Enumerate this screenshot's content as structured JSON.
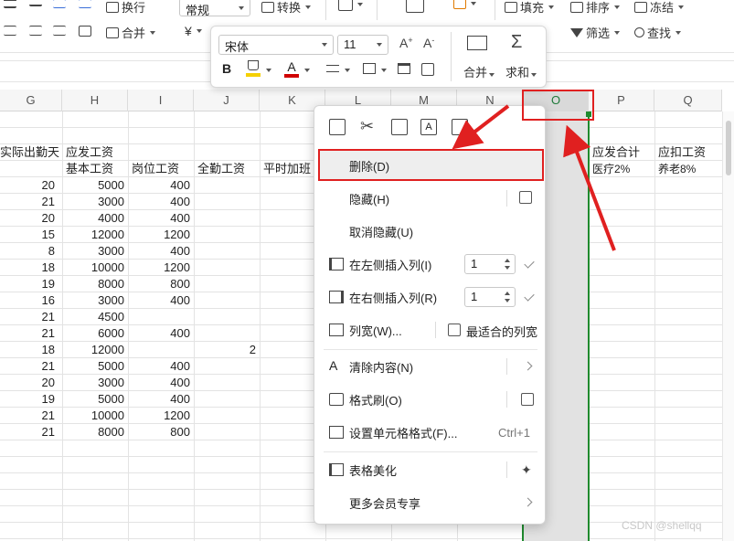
{
  "toolbar": {
    "wrap_label": "换行",
    "format_value": "常规",
    "convert_label": "转换",
    "fill_label": "填充",
    "sort_label": "排序",
    "freeze_label": "冻结",
    "merge_label": "合并",
    "currency_symbol": "¥",
    "filter_label": "筛选",
    "find_label": "查找"
  },
  "format_popup": {
    "font_name": "宋体",
    "font_size": "11",
    "bold_label": "B",
    "merge_label": "合并",
    "sum_label": "求和",
    "highlight_color": "#f5d000",
    "font_color": "#d00000"
  },
  "columns": [
    "G",
    "H",
    "I",
    "J",
    "K",
    "L",
    "M",
    "N",
    "O",
    "P",
    "Q"
  ],
  "selected_column": "O",
  "header_rows": {
    "row1": {
      "G": "实际出勤天",
      "H": "应发工资",
      "P": "应发合计",
      "Q": "应扣工资"
    },
    "row2": {
      "H": "基本工资",
      "I": "岗位工资",
      "J": "全勤工资",
      "K": "平时加班",
      "P": "医疗2%",
      "Q": "养老8%"
    }
  },
  "data_rows": [
    {
      "G": "20",
      "H": "5000",
      "I": "400",
      "J": ""
    },
    {
      "G": "21",
      "H": "3000",
      "I": "400",
      "J": ""
    },
    {
      "G": "20",
      "H": "4000",
      "I": "400",
      "J": ""
    },
    {
      "G": "15",
      "H": "12000",
      "I": "1200",
      "J": ""
    },
    {
      "G": "8",
      "H": "3000",
      "I": "400",
      "J": ""
    },
    {
      "G": "18",
      "H": "10000",
      "I": "1200",
      "J": ""
    },
    {
      "G": "19",
      "H": "8000",
      "I": "800",
      "J": ""
    },
    {
      "G": "16",
      "H": "3000",
      "I": "400",
      "J": ""
    },
    {
      "G": "21",
      "H": "4500",
      "I": "",
      "J": ""
    },
    {
      "G": "21",
      "H": "6000",
      "I": "400",
      "J": ""
    },
    {
      "G": "18",
      "H": "12000",
      "I": "",
      "J": "2"
    },
    {
      "G": "21",
      "H": "5000",
      "I": "400",
      "J": ""
    },
    {
      "G": "20",
      "H": "3000",
      "I": "400",
      "J": ""
    },
    {
      "G": "19",
      "H": "5000",
      "I": "400",
      "J": ""
    },
    {
      "G": "21",
      "H": "10000",
      "I": "1200",
      "J": ""
    },
    {
      "G": "21",
      "H": "8000",
      "I": "800",
      "J": ""
    }
  ],
  "context_menu": {
    "delete": "删除(D)",
    "hide": "隐藏(H)",
    "unhide": "取消隐藏(U)",
    "insert_left": "在左侧插入列(I)",
    "insert_left_count": "1",
    "insert_right": "在右侧插入列(R)",
    "insert_right_count": "1",
    "col_width": "列宽(W)...",
    "best_fit": "最适合的列宽",
    "clear": "清除内容(N)",
    "format_painter": "格式刷(O)",
    "cell_format": "设置单元格格式(F)...",
    "cell_format_shortcut": "Ctrl+1",
    "beautify": "表格美化",
    "more_member": "更多会员专享"
  },
  "accent_colors": {
    "annotation_red": "#e02020",
    "selection_green": "#1f8a2e"
  },
  "watermark": "CSDN @shellqq"
}
